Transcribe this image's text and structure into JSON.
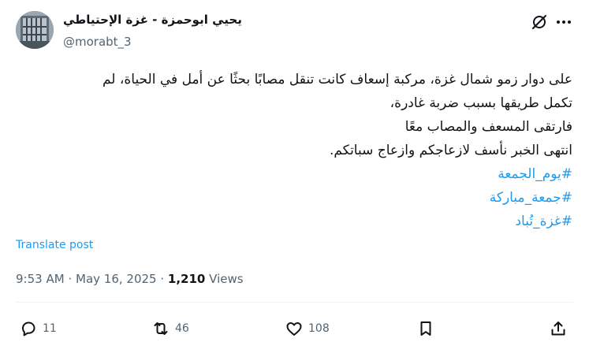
{
  "author": {
    "display_name": "يحيي ابوحمزة - غزة الإحتياطي",
    "handle": "@morabt_3"
  },
  "post": {
    "lines": [
      "على دوار زمو شمال غزة، مركبة إسعاف كانت تنقل مصابًا بحثًا عن أمل في الحياة، لم",
      "تكمل طريقها بسبب ضربة غادرة،",
      "فارتقى المسعف والمصاب معًا",
      "انتهى الخبر نأسف لازعاجكم وازعاج سباتكم."
    ],
    "hashtags": [
      "#يوم_الجمعة",
      "#جمعة_مباركة",
      "#غزة_تُباد"
    ],
    "translate_label": "Translate post"
  },
  "meta": {
    "time": "9:53 AM",
    "separator": "·",
    "date": "May 16, 2025",
    "views_count": "1,210",
    "views_label": "Views"
  },
  "actions": {
    "replies": "11",
    "reposts": "46",
    "likes": "108"
  },
  "colors": {
    "text": "#0f1419",
    "secondary": "#536471",
    "link": "#1d9bf0",
    "divider": "#eff3f4"
  },
  "icons": [
    "grok-icon",
    "more-icon",
    "reply-icon",
    "repost-icon",
    "like-icon",
    "bookmark-icon",
    "share-icon"
  ]
}
